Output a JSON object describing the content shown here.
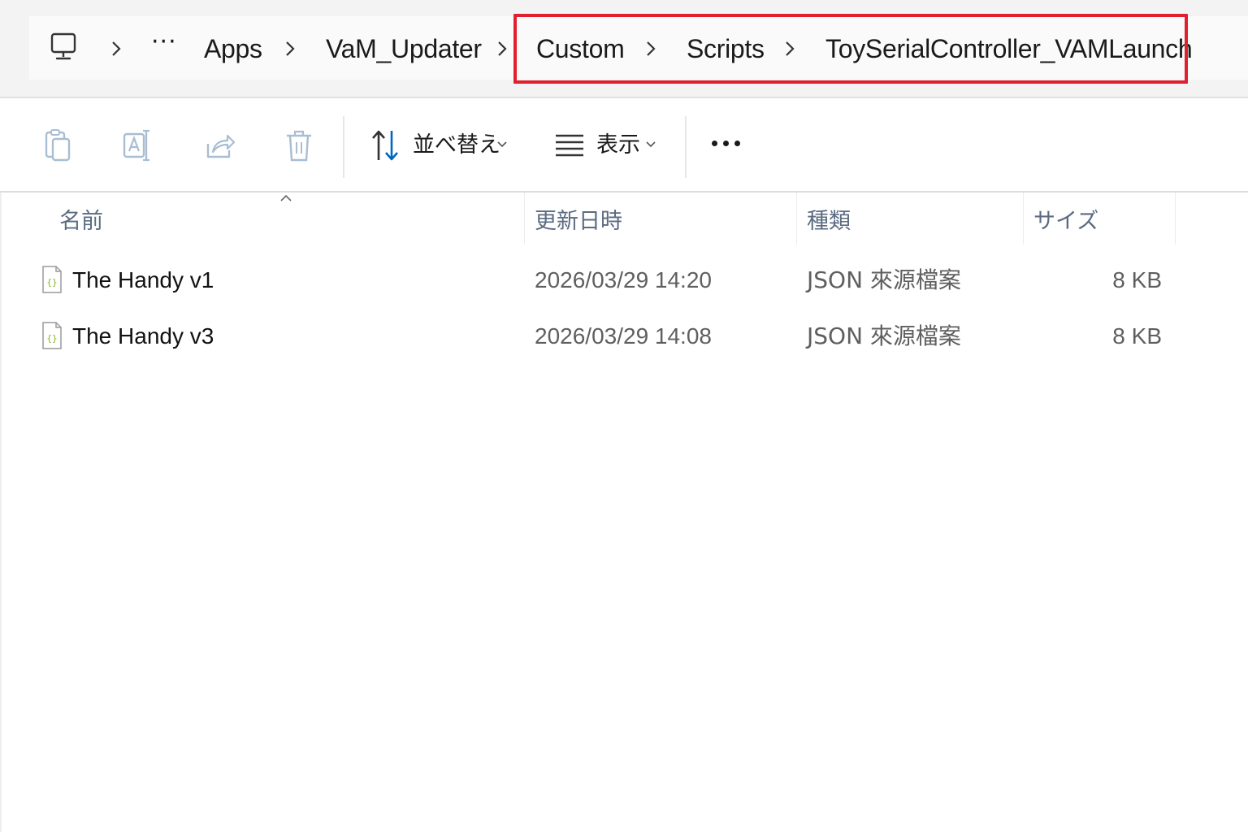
{
  "breadcrumb": {
    "root_icon": "computer-icon",
    "overflow": "···",
    "items": [
      "Apps",
      "VaM_Updater",
      "Custom",
      "Scripts",
      "ToySerialController_VAMLaunch"
    ],
    "highlight_color": "#e0202e"
  },
  "toolbar": {
    "copy_icon": "copy-icon",
    "rename_icon": "rename-icon",
    "share_icon": "share-icon",
    "delete_icon": "delete-icon",
    "sort_label": "並べ替え",
    "view_label": "表示",
    "more_icon": "more-options-icon",
    "accent_color": "#0067c0"
  },
  "columns": {
    "name": "名前",
    "date_modified": "更新日時",
    "type": "種類",
    "size": "サイズ",
    "sort_indicator": "sort-ascending-icon"
  },
  "files": [
    {
      "name": "The Handy v1",
      "date_modified": "2026/03/29 14:20",
      "type": "JSON 來源檔案",
      "size": "8 KB",
      "icon": "json-file-icon"
    },
    {
      "name": "The Handy v3",
      "date_modified": "2026/03/29 14:08",
      "type": "JSON 來源檔案",
      "size": "8 KB",
      "icon": "json-file-icon"
    }
  ]
}
